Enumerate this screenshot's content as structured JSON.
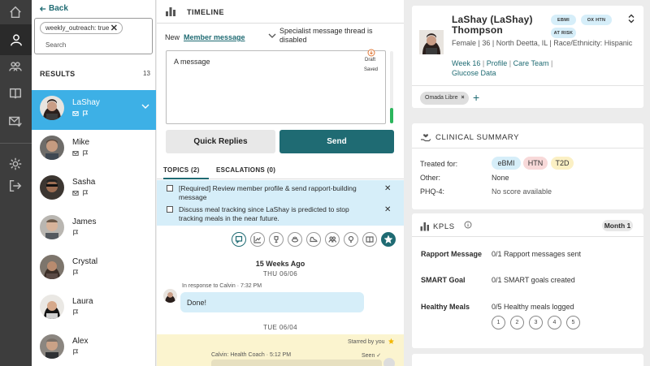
{
  "nav": {
    "back_label": "Back"
  },
  "filter": {
    "chip_label": "weekly_outreach: true",
    "chip_close": "✕",
    "search_placeholder": "Search"
  },
  "results": {
    "title": "RESULTS",
    "count": "13",
    "members": [
      {
        "name": "LaShay",
        "selected": true
      },
      {
        "name": "Mike"
      },
      {
        "name": "Sasha"
      },
      {
        "name": "James"
      },
      {
        "name": "Crystal"
      },
      {
        "name": "Laura"
      },
      {
        "name": "Alex"
      }
    ]
  },
  "timeline": {
    "title": "TIMELINE",
    "new_label": "New",
    "message_type": "Member message",
    "thread_note": "Specialist message thread is disabled",
    "composer_text": "A message",
    "draft_label": "Draft",
    "saved_label": "Saved",
    "quick_replies_label": "Quick Replies",
    "send_label": "Send",
    "tabs": [
      {
        "label": "TOPICS (2)"
      },
      {
        "label": "ESCALATIONS (0)"
      }
    ],
    "topics": [
      {
        "text": "[Required] Review member profile & send rapport-building message"
      },
      {
        "text": "Discuss meal tracking since LaShay is predicted to stop tracking meals in the near future."
      }
    ],
    "topic_close": "✕",
    "weeks_ago": "15 Weeks Ago",
    "date1": "THU 06/06",
    "in_response": "In response to Calvin · 7:32 PM",
    "message1": "Done!",
    "date2": "TUE 06/04",
    "starred_label": "Starred by you",
    "coach_label": "Calvin: Health Coach · 5:12 PM",
    "seen_label": "Seen ✓"
  },
  "patient": {
    "name": "LaShay (LaShay) Thompson",
    "badges": [
      "EBMI",
      "OX HTN",
      "AT RISK"
    ],
    "demographics": "Female | 36 | North Deetta, IL | Race/Ethnicity: Hispanic",
    "links": [
      "Week 16",
      "Profile",
      "Care Team",
      "Glucose Data"
    ],
    "link_sep": "|",
    "device": "Omada Libre",
    "device_close": "×",
    "add": "+"
  },
  "clinical": {
    "title": "CLINICAL SUMMARY",
    "treated_label": "Treated for:",
    "conditions": [
      "eBMI",
      "HTN",
      "T2D"
    ],
    "other_label": "Other:",
    "other_value": "None",
    "phq_label": "PHQ-4:",
    "phq_value": "No score available",
    "colors": {
      "ebmi": "#d6eef9",
      "htn": "#f8d9d9",
      "t2d": "#fbf0c4"
    }
  },
  "kpls": {
    "title": "KPLS",
    "month_label": "Month 1",
    "rows": [
      {
        "label": "Rapport Message",
        "value": "0/1 Rapport messages sent"
      },
      {
        "label": "SMART Goal",
        "value": "0/1 SMART goals created"
      },
      {
        "label": "Healthy Meals",
        "value": "0/5 Healthy meals logged"
      }
    ],
    "ratings": [
      "1",
      "2",
      "3",
      "4",
      "5"
    ]
  },
  "colors": {
    "accent": "#1f6b73",
    "selected": "#3db0e6",
    "rail": "#3d3d3d"
  }
}
